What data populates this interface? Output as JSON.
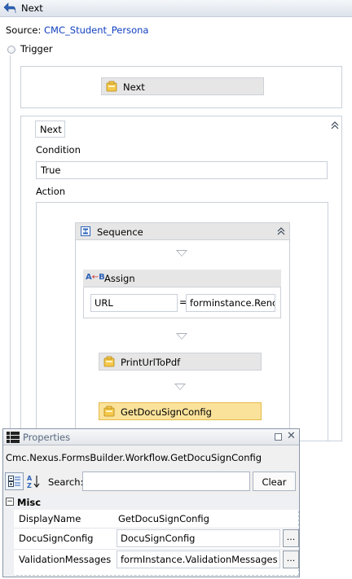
{
  "header": {
    "title": "Next",
    "back_icon": "back-arrow-icon"
  },
  "source": {
    "label": "Source:",
    "value": "CMC_Student_Persona"
  },
  "trigger": {
    "label": "Trigger",
    "activity": "Next"
  },
  "transition": {
    "tag": "Next",
    "condition_label": "Condition",
    "condition_value": "True",
    "action_label": "Action",
    "sequence": {
      "title": "Sequence",
      "assign": {
        "title": "Assign",
        "to": "URL",
        "eq": "=",
        "value": "forminstance.Renc"
      },
      "activities": [
        "PrintUrlToPdf",
        "GetDocuSignConfig"
      ]
    }
  },
  "properties": {
    "title": "Properties",
    "type_name": "Cmc.Nexus.FormsBuilder.Workflow.GetDocuSignConfig",
    "search_label": "Search:",
    "search_value": "",
    "clear_label": "Clear",
    "category": "Misc",
    "rows": [
      {
        "name": "DisplayName",
        "value": "GetDocuSignConfig"
      },
      {
        "name": "DocuSignConfig",
        "value": "DocuSignConfig"
      },
      {
        "name": "ValidationMessages",
        "value": "formInstance.ValidationMessages"
      }
    ],
    "ellipsis": "..."
  },
  "colors": {
    "selected_bg": "#fbe29a",
    "link": "#1240c0",
    "activity_bg": "#e6e6e6"
  }
}
